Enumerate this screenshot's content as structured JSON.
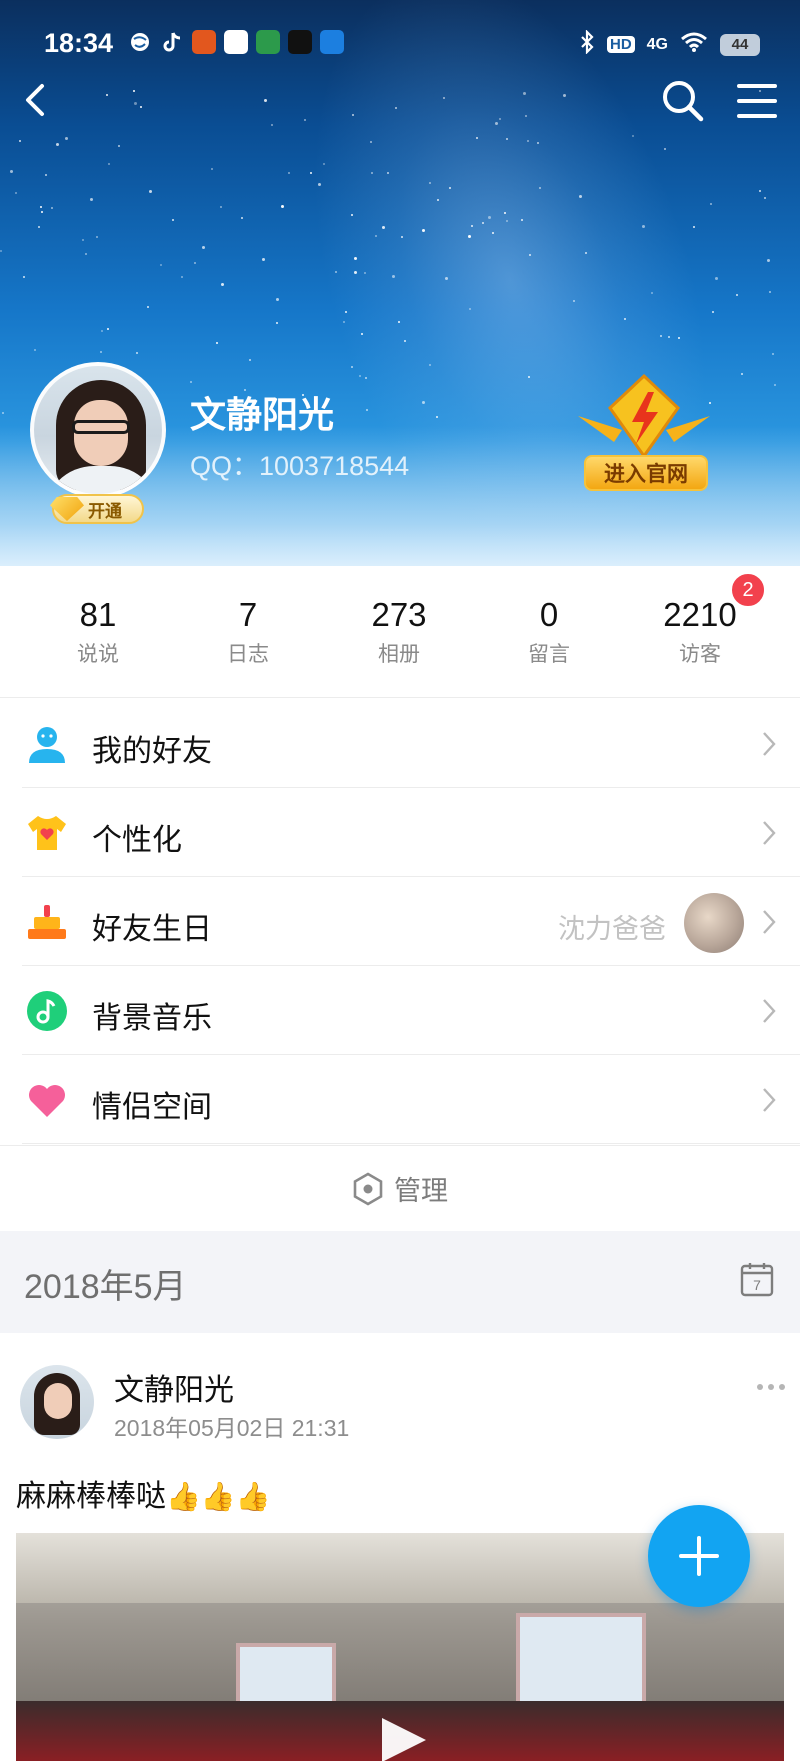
{
  "status_bar": {
    "time": "18:34",
    "signal": "4G",
    "hd": "HD",
    "battery": "44"
  },
  "profile": {
    "name": "文静阳光",
    "qq": "QQ：1003718544",
    "vip_label": "开通",
    "official_label": "进入官网"
  },
  "stats": [
    {
      "value": "81",
      "label": "说说"
    },
    {
      "value": "7",
      "label": "日志"
    },
    {
      "value": "273",
      "label": "相册"
    },
    {
      "value": "0",
      "label": "留言"
    },
    {
      "value": "2210",
      "label": "访客"
    }
  ],
  "visitor_badge": "2",
  "menu": [
    {
      "label": "我的好友",
      "icon": "friends-icon"
    },
    {
      "label": "个性化",
      "icon": "personalize-icon"
    },
    {
      "label": "好友生日",
      "icon": "birthday-cake-icon",
      "extra_text": "沈力爸爸"
    },
    {
      "label": "背景音乐",
      "icon": "music-note-icon"
    },
    {
      "label": "情侣空间",
      "icon": "heart-icon"
    }
  ],
  "manage_label": "管理",
  "month": {
    "label": "2018年5月",
    "calendar_day": "7"
  },
  "post": {
    "author": "文静阳光",
    "time": "2018年05月02日 21:31",
    "text": "麻麻棒棒哒",
    "emoji": "👍👍👍"
  },
  "colors": {
    "accent": "#12a4f2",
    "badge": "#f2414d",
    "muted_text": "#8a8a8a"
  }
}
